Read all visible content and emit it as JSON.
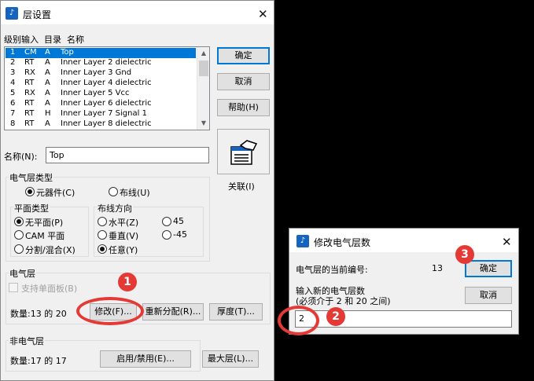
{
  "main_dialog": {
    "title": "层设置",
    "list_header": "级别输入  目录  名称",
    "layers": [
      {
        "num": "1",
        "code": "CM",
        "type": "A",
        "name": "Top",
        "selected": true
      },
      {
        "num": "2",
        "code": "RT",
        "type": "A",
        "name": "Inner Layer 2 dielectric"
      },
      {
        "num": "3",
        "code": "RX",
        "type": "A",
        "name": "Inner Layer 3 Gnd"
      },
      {
        "num": "4",
        "code": "RT",
        "type": "A",
        "name": "Inner Layer 4 dielectric"
      },
      {
        "num": "5",
        "code": "RX",
        "type": "A",
        "name": "Inner Layer 5 Vcc"
      },
      {
        "num": "6",
        "code": "RT",
        "type": "A",
        "name": "Inner Layer 6 dielectric"
      },
      {
        "num": "7",
        "code": "RT",
        "type": "H",
        "name": "Inner Layer 7 Signal 1"
      },
      {
        "num": "8",
        "code": "RT",
        "type": "A",
        "name": "Inner Layer 8 dielectric"
      }
    ],
    "buttons": {
      "ok": "确定",
      "cancel": "取消",
      "help": "帮助(H)",
      "associate": "关联(I)"
    },
    "name_label": "名称(N):",
    "name_value": "Top",
    "electrical_type": {
      "label": "电气层类型",
      "component": "元器件(C)",
      "routing": "布线(U)"
    },
    "plane_type": {
      "label": "平面类型",
      "no_plane": "无平面(P)",
      "cam_plane": "CAM 平面",
      "split_mixed": "分割/混合(X)"
    },
    "routing_direction": {
      "label": "布线方向",
      "horizontal": "水平(Z)",
      "vertical": "垂直(V)",
      "any": "任意(Y)",
      "deg45": "45",
      "degm45": "-45"
    },
    "electrical_layer": {
      "label": "电气层",
      "single_sided": "支持单面板(B)",
      "count_text": "数量:13 的 20",
      "modify": "修改(F)...",
      "reassign": "重新分配(R)...",
      "thickness": "厚度(T)..."
    },
    "nonelectrical_layer": {
      "label": "非电气层",
      "count_text": "数量:17 的 17",
      "enable_disable": "启用/禁用(E)...",
      "max_layers": "最大层(L)..."
    }
  },
  "modify_dialog": {
    "title": "修改电气层数",
    "current_label": "电气层的当前编号:",
    "current_value": "13",
    "input_label_line1": "输入新的电气层数",
    "input_label_line2": "(必须介于 2 和 20 之间)",
    "input_value": "2",
    "ok": "确定",
    "cancel": "取消"
  },
  "annotations": {
    "badge1": "1",
    "badge2": "2",
    "badge3": "3",
    "color": "#e53935"
  },
  "app_icon_glyph": "♪",
  "close_glyph": "✕",
  "scroll_up": "▲",
  "scroll_down": "▼"
}
